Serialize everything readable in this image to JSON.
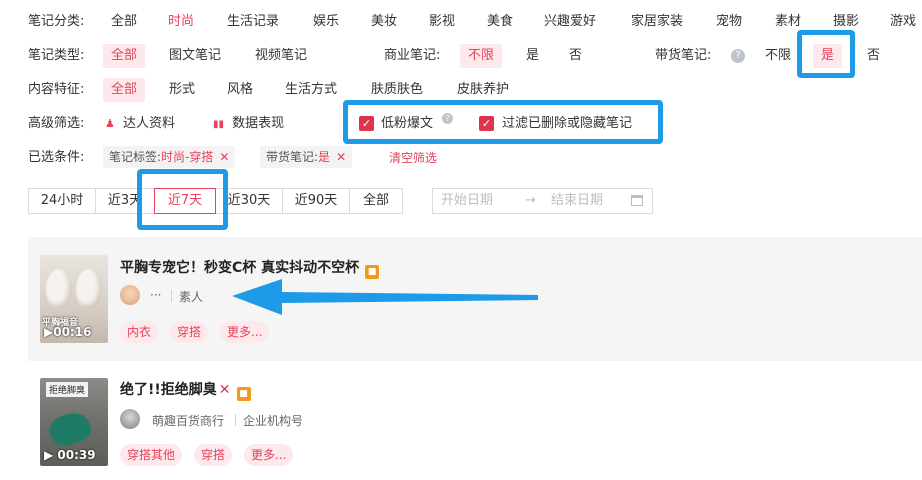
{
  "filters": {
    "category": {
      "label": "笔记分类:",
      "options": [
        "全部",
        "时尚",
        "生活记录",
        "娱乐",
        "美妆",
        "影视",
        "美食",
        "兴趣爱好",
        "家居家装",
        "宠物",
        "素材",
        "摄影",
        "游戏"
      ],
      "selected": "时尚"
    },
    "type": {
      "label": "笔记类型:",
      "options": [
        "全部",
        "图文笔记",
        "视频笔记"
      ],
      "selected": "全部",
      "commercial": {
        "label": "商业笔记:",
        "options": [
          "不限",
          "是",
          "否"
        ],
        "selected": "不限"
      },
      "goods": {
        "label": "带货笔记:",
        "options": [
          "不限",
          "是",
          "否"
        ],
        "selected": "是",
        "help_icon": "question-circle"
      }
    },
    "feature": {
      "label": "内容特征:",
      "options": [
        "全部",
        "形式",
        "风格",
        "生活方式",
        "肤质肤色",
        "皮肤养护"
      ],
      "selected": "全部"
    },
    "advanced": {
      "label": "高级筛选:",
      "kol_label": "达人资料",
      "data_label": "数据表现",
      "low_fans_label": "低粉爆文",
      "filter_deleted_label": "过滤已删除或隐藏笔记",
      "low_fans_checked": true,
      "filter_deleted_checked": true
    },
    "selected": {
      "label": "已选条件:",
      "tags": [
        {
          "key": "笔记标签:",
          "value": "时尚-穿搭"
        },
        {
          "key": "带货笔记:",
          "value": "是"
        }
      ],
      "clear_label": "清空筛选"
    }
  },
  "time_range": {
    "options": [
      "24小时",
      "近3天",
      "近7天",
      "近30天",
      "近90天",
      "全部"
    ],
    "selected": "近7天",
    "start_placeholder": "开始日期",
    "end_placeholder": "结束日期",
    "arrow": "→"
  },
  "notes": [
    {
      "title": "平胸专宠它！秒变C杯 真实抖动不空杯",
      "duration": "00:16",
      "thumb_caption": "平胸福音",
      "author": "···",
      "author_type": "素人",
      "tags": [
        "内衣",
        "穿搭",
        "更多..."
      ]
    },
    {
      "title": "绝了!!拒绝脚臭",
      "duration": "00:39",
      "thumb_caption": "拒绝脚臭",
      "author": "萌趣百货商行",
      "author_type": "企业机构号",
      "tags": [
        "穿搭其他",
        "穿搭",
        "更多..."
      ]
    }
  ],
  "colors": {
    "accent": "#e8425a",
    "highlight": "#1e9be8",
    "badge": "#f39a1e"
  }
}
